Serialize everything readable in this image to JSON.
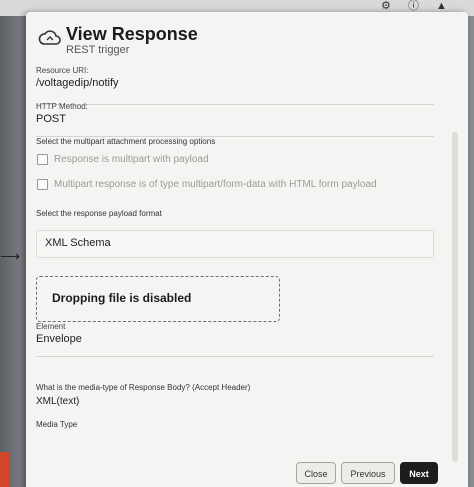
{
  "dialog": {
    "title": "View Response",
    "subtitle": "REST trigger"
  },
  "resource_uri": {
    "label": "Resource URI:",
    "value": "/voltagedip/notify"
  },
  "http_method": {
    "label": "HTTP Method:",
    "value": "POST"
  },
  "multipart": {
    "label": "Select the multipart attachment processing options",
    "options": [
      "Response is multipart with payload",
      "Multipart response is of type multipart/form-data with HTML form payload"
    ]
  },
  "payload_format": {
    "label": "Select the response payload format",
    "value": "XML Schema"
  },
  "dropzone": {
    "text": "Dropping file is disabled"
  },
  "element": {
    "label": "Element",
    "value": "Envelope"
  },
  "media_type_question": {
    "label": "What is the media-type of Response Body? (Accept Header)",
    "value": "XML(text)"
  },
  "media_type": {
    "label": "Media Type"
  },
  "footer": {
    "close": "Close",
    "previous": "Previous",
    "next": "Next"
  },
  "topbar_icons": [
    "gear-icon",
    "info-icon",
    "warning-icon"
  ],
  "colors": {
    "primary_button": "#1d1d1d",
    "panel_bg": "#f4f4f2",
    "accent_left": "#d0472c"
  }
}
